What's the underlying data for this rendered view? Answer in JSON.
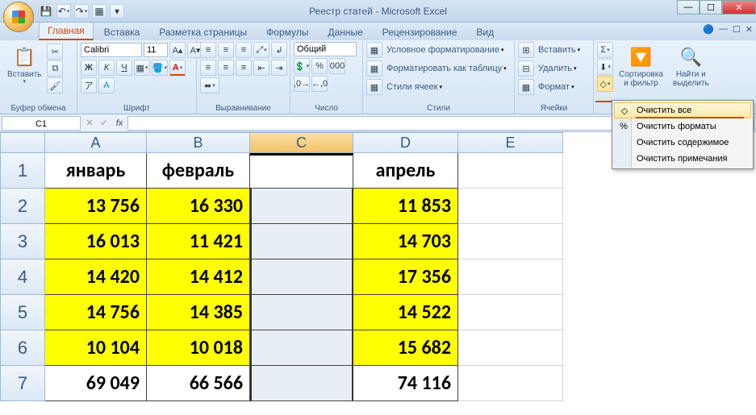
{
  "title": "Реестр статей - Microsoft Excel",
  "qat": {
    "save": "💾",
    "undo": "↶",
    "redo": "↷",
    "grid": "▦"
  },
  "tabs": [
    "Главная",
    "Вставка",
    "Разметка страницы",
    "Формулы",
    "Данные",
    "Рецензирование",
    "Вид"
  ],
  "ribbon": {
    "clipboard": {
      "label": "Буфер обмена",
      "paste": "Вставить"
    },
    "font": {
      "label": "Шрифт",
      "family": "Calibri",
      "size": "11"
    },
    "align": {
      "label": "Выравнивание"
    },
    "number": {
      "label": "Число",
      "format": "Общий"
    },
    "styles": {
      "label": "Стили",
      "cond": "Условное форматирование",
      "table": "Форматировать как таблицу",
      "cell": "Стили ячеек"
    },
    "cells": {
      "label": "Ячейки",
      "insert": "Вставить",
      "delete": "Удалить",
      "format": "Формат"
    },
    "editing": {
      "label": "",
      "sort": "Сортировка\nи фильтр",
      "find": "Найти и\nвыделить"
    }
  },
  "namebox": "C1",
  "menu": {
    "clear_all": "Очистить все",
    "clear_formats": "Очистить форматы",
    "clear_contents": "Очистить содержимое",
    "clear_comments": "Очистить примечания"
  },
  "cols": [
    "A",
    "B",
    "C",
    "D",
    "E"
  ],
  "rows": [
    "1",
    "2",
    "3",
    "4",
    "5",
    "6",
    "7"
  ],
  "data": {
    "headers": {
      "a": "январь",
      "b": "февраль",
      "c": "",
      "d": "апрель"
    },
    "r2": {
      "a": "13 756",
      "b": "16 330",
      "d": "11 853"
    },
    "r3": {
      "a": "16 013",
      "b": "11 421",
      "d": "14 703"
    },
    "r4": {
      "a": "14 420",
      "b": "14 412",
      "d": "17 356"
    },
    "r5": {
      "a": "14 756",
      "b": "14 385",
      "d": "14 522"
    },
    "r6": {
      "a": "10 104",
      "b": "10 018",
      "d": "15 682"
    },
    "r7": {
      "a": "69 049",
      "b": "66 566",
      "d": "74 116"
    }
  }
}
